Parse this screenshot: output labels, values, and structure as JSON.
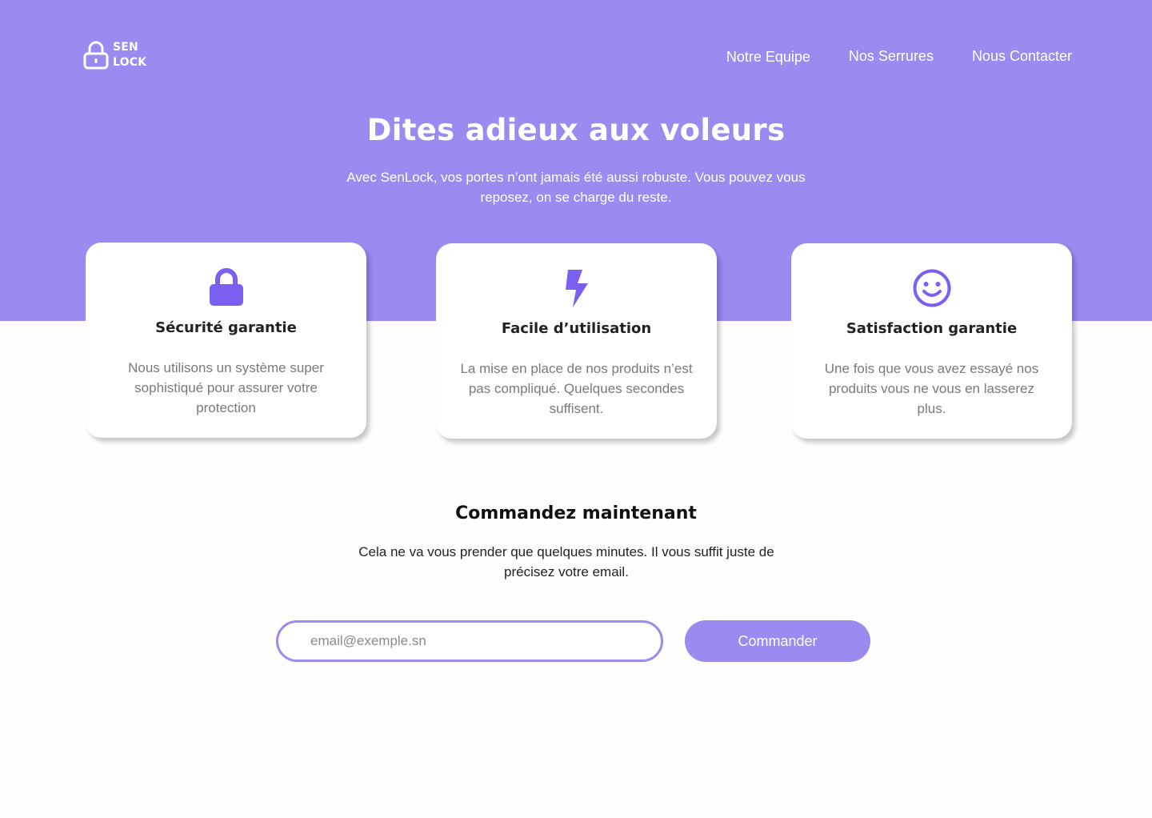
{
  "brand": {
    "line1": "SEN",
    "line2": "LOCK",
    "icon": "lock-outline-icon"
  },
  "nav": {
    "items": [
      {
        "label": "Notre Equipe"
      },
      {
        "label": "Nos Serrures"
      },
      {
        "label": "Nous Contacter"
      }
    ]
  },
  "hero": {
    "title": "Dites adieux aux voleurs",
    "subtitle": "Avec SenLock, vos portes n’ont jamais été aussi robuste. Vous pouvez vous reposez, on se charge du reste."
  },
  "features": [
    {
      "icon": "lock-icon",
      "title": "Sécurité garantie",
      "text": "Nous utilisons un système super sophistiqué pour assurer votre protection"
    },
    {
      "icon": "lightning-icon",
      "title": "Facile d’utilisation",
      "text": "La mise en place de nos produits n’est pas compliqué. Quelques secondes suffisent."
    },
    {
      "icon": "smiley-icon",
      "title": "Satisfaction garantie",
      "text": "Une fois que vous avez essayé nos produits vous ne vous en lasserez plus."
    }
  ],
  "order": {
    "title": "Commandez maintenant",
    "text": "Cela ne va vous prender que quelques minutes. Il vous suffit juste de précisez votre email.",
    "email_placeholder": "email@exemple.sn",
    "email_value": "",
    "button_label": "Commander"
  },
  "colors": {
    "accent": "#9b8af0",
    "icon": "#7b5ff0",
    "background": "#fffefc"
  }
}
